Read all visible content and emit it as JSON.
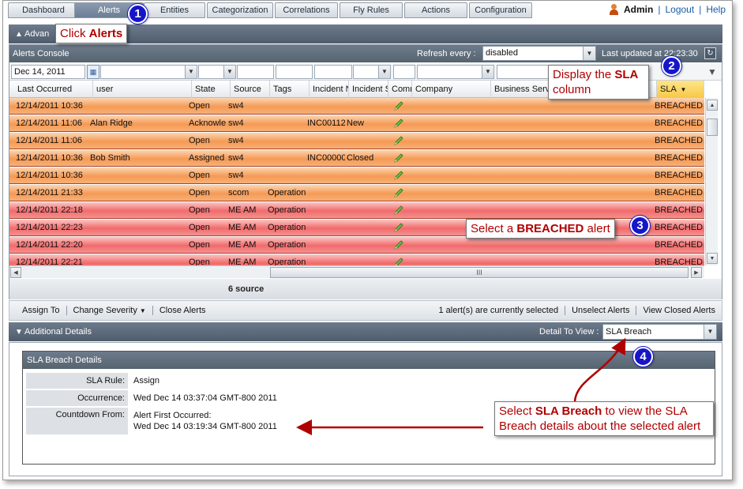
{
  "nav": {
    "tabs": [
      "Dashboard",
      "Alerts",
      "Entities",
      "Categorization",
      "Correlations",
      "Fly Rules",
      "Actions",
      "Configuration"
    ],
    "active_tab": "Alerts",
    "user": "Admin",
    "logout": "Logout",
    "help": "Help",
    "sep1": "|",
    "sep2": "|"
  },
  "advanced_bar": {
    "label": "Advan"
  },
  "console": {
    "title": "Alerts Console",
    "refresh_label": "Refresh every :",
    "refresh_value": "disabled",
    "last_updated": "Last updated at 22:23:30",
    "filter_date": "Dec 14, 2011",
    "columns": [
      "Last Occurred",
      "user",
      "State",
      "Source",
      "Tags",
      "Incident N",
      "Incident S",
      "Comn",
      "Company",
      "Business Serv",
      "",
      "SLA"
    ],
    "rows": [
      {
        "time": "12/14/2011 10:36",
        "user": "",
        "state": "Open",
        "source": "sw4",
        "tags": "",
        "incident_no": "",
        "incident_status": "",
        "sla": "BREACHED",
        "color": "orange"
      },
      {
        "time": "12/14/2011 11:06",
        "user": "Alan Ridge",
        "state": "Acknowle",
        "source": "sw4",
        "tags": "",
        "incident_no": "INC00112",
        "incident_status": "New",
        "sla": "BREACHED",
        "color": "orange"
      },
      {
        "time": "12/14/2011 11:06",
        "user": "",
        "state": "Open",
        "source": "sw4",
        "tags": "",
        "incident_no": "",
        "incident_status": "",
        "sla": "BREACHED",
        "color": "orange"
      },
      {
        "time": "12/14/2011 10:36",
        "user": "Bob Smith",
        "state": "Assigned",
        "source": "sw4",
        "tags": "",
        "incident_no": "INC00000",
        "incident_status": "Closed",
        "sla": "BREACHED",
        "color": "orange"
      },
      {
        "time": "12/14/2011 10:36",
        "user": "",
        "state": "Open",
        "source": "sw4",
        "tags": "",
        "incident_no": "",
        "incident_status": "",
        "sla": "BREACHED",
        "color": "orange"
      },
      {
        "time": "12/14/2011 21:33",
        "user": "",
        "state": "Open",
        "source": "scom",
        "tags": "Operation",
        "incident_no": "",
        "incident_status": "",
        "sla": "BREACHED",
        "color": "orange"
      },
      {
        "time": "12/14/2011 22:18",
        "user": "",
        "state": "Open",
        "source": "ME AM",
        "tags": "Operation",
        "incident_no": "",
        "incident_status": "",
        "sla": "BREACHED",
        "color": "red"
      },
      {
        "time": "12/14/2011 22:23",
        "user": "",
        "state": "Open",
        "source": "ME AM",
        "tags": "Operation",
        "incident_no": "",
        "incident_status": "",
        "sla": "BREACHED",
        "color": "red"
      },
      {
        "time": "12/14/2011 22:20",
        "user": "",
        "state": "Open",
        "source": "ME AM",
        "tags": "Operation",
        "incident_no": "",
        "incident_status": "",
        "sla": "BREACHED",
        "color": "red"
      },
      {
        "time": "12/14/2011 22:21",
        "user": "",
        "state": "Open",
        "source": "ME AM",
        "tags": "Operation",
        "incident_no": "",
        "incident_status": "",
        "sla": "BREACHED",
        "color": "red"
      }
    ],
    "footer_sources": "6 source",
    "hscroll_grip": "III"
  },
  "actions": {
    "assign": "Assign To",
    "change_severity": "Change Severity",
    "close": "Close Alerts",
    "selected_info": "1 alert(s) are currently selected",
    "unselect": "Unselect Alerts",
    "view_closed": "View Closed Alerts"
  },
  "details": {
    "title": "Additional Details",
    "detail_label": "Detail To View :",
    "detail_value": "SLA Breach",
    "box_title": "SLA Breach Details",
    "sla_rule_label": "SLA Rule:",
    "sla_rule_value": "Assign",
    "occurrence_label": "Occurrence:",
    "occurrence_value": "Wed Dec 14 03:37:04 GMT-800 2011",
    "countdown_label": "Countdown From:",
    "countdown_value_1": "Alert First Occurred:",
    "countdown_value_2": "Wed Dec 14 03:19:34 GMT-800 2011"
  },
  "callouts": {
    "c1_prefix": "Click ",
    "c1_bold": "Alerts",
    "c2_prefix": "Display the ",
    "c2_bold": "SLA",
    "c2_suffix": "column",
    "c3_prefix": "Select a ",
    "c3_bold": "BREACHED",
    "c3_suffix": " alert",
    "c4_prefix": "Select ",
    "c4_bold": "SLA Breach",
    "c4_suffix": " to view the SLA",
    "c4_line2": "Breach details about the selected alert",
    "badges": [
      "1",
      "2",
      "3",
      "4"
    ]
  },
  "colors": {
    "orange_row": "#f59a55",
    "red_row": "#f16b6b",
    "header": "#5f6d7d",
    "callout_text": "#b00000",
    "badge": "#1616c8"
  }
}
